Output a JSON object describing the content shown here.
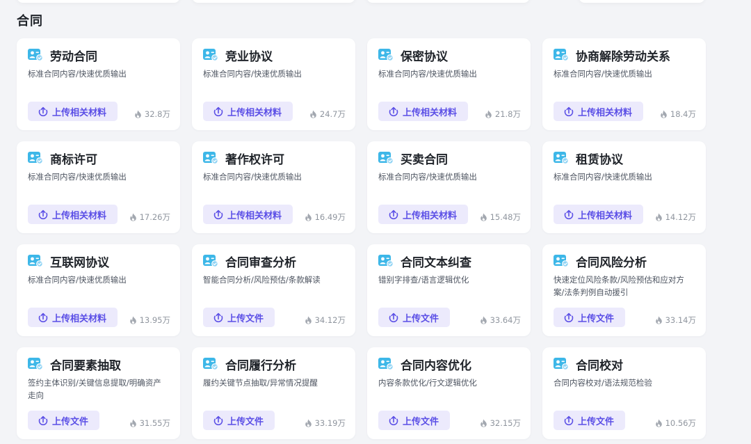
{
  "section": {
    "title": "合同"
  },
  "colors": {
    "accent": "#5b4fe6",
    "button_bg": "#eceafc",
    "icon_primary": "#3db7e8"
  },
  "cards": [
    {
      "title": "劳动合同",
      "desc": "标准合同内容/快速优质输出",
      "button": "上传相关材料",
      "count": "32.8万"
    },
    {
      "title": "竞业协议",
      "desc": "标准合同内容/快速优质输出",
      "button": "上传相关材料",
      "count": "24.7万"
    },
    {
      "title": "保密协议",
      "desc": "标准合同内容/快速优质输出",
      "button": "上传相关材料",
      "count": "21.8万"
    },
    {
      "title": "协商解除劳动关系",
      "desc": "标准合同内容/快速优质输出",
      "button": "上传相关材料",
      "count": "18.4万"
    },
    {
      "title": "商标许可",
      "desc": "标准合同内容/快速优质输出",
      "button": "上传相关材料",
      "count": "17.26万"
    },
    {
      "title": "著作权许可",
      "desc": "标准合同内容/快速优质输出",
      "button": "上传相关材料",
      "count": "16.49万"
    },
    {
      "title": "买卖合同",
      "desc": "标准合同内容/快速优质输出",
      "button": "上传相关材料",
      "count": "15.48万"
    },
    {
      "title": "租赁协议",
      "desc": "标准合同内容/快速优质输出",
      "button": "上传相关材料",
      "count": "14.12万"
    },
    {
      "title": "互联网协议",
      "desc": "标准合同内容/快速优质输出",
      "button": "上传相关材料",
      "count": "13.95万"
    },
    {
      "title": "合同审查分析",
      "desc": "智能合同分析/风险预估/条款解读",
      "button": "上传文件",
      "count": "34.12万"
    },
    {
      "title": "合同文本纠查",
      "desc": "错别字排查/语言逻辑优化",
      "button": "上传文件",
      "count": "33.64万"
    },
    {
      "title": "合同风险分析",
      "desc": "快速定位风险条款/风险预估和应对方案/法条判例自动援引",
      "button": "上传文件",
      "count": "33.14万"
    },
    {
      "title": "合同要素抽取",
      "desc": "签约主体识别/关键信息提取/明确资产走向",
      "button": "上传文件",
      "count": "31.55万"
    },
    {
      "title": "合同履行分析",
      "desc": "履约关键节点抽取/异常情况提醒",
      "button": "上传文件",
      "count": "33.19万"
    },
    {
      "title": "合同内容优化",
      "desc": "内容条款优化/行文逻辑优化",
      "button": "上传文件",
      "count": "32.15万"
    },
    {
      "title": "合同校对",
      "desc": "合同内容校对/语法规范检验",
      "button": "上传文件",
      "count": "10.56万"
    }
  ]
}
